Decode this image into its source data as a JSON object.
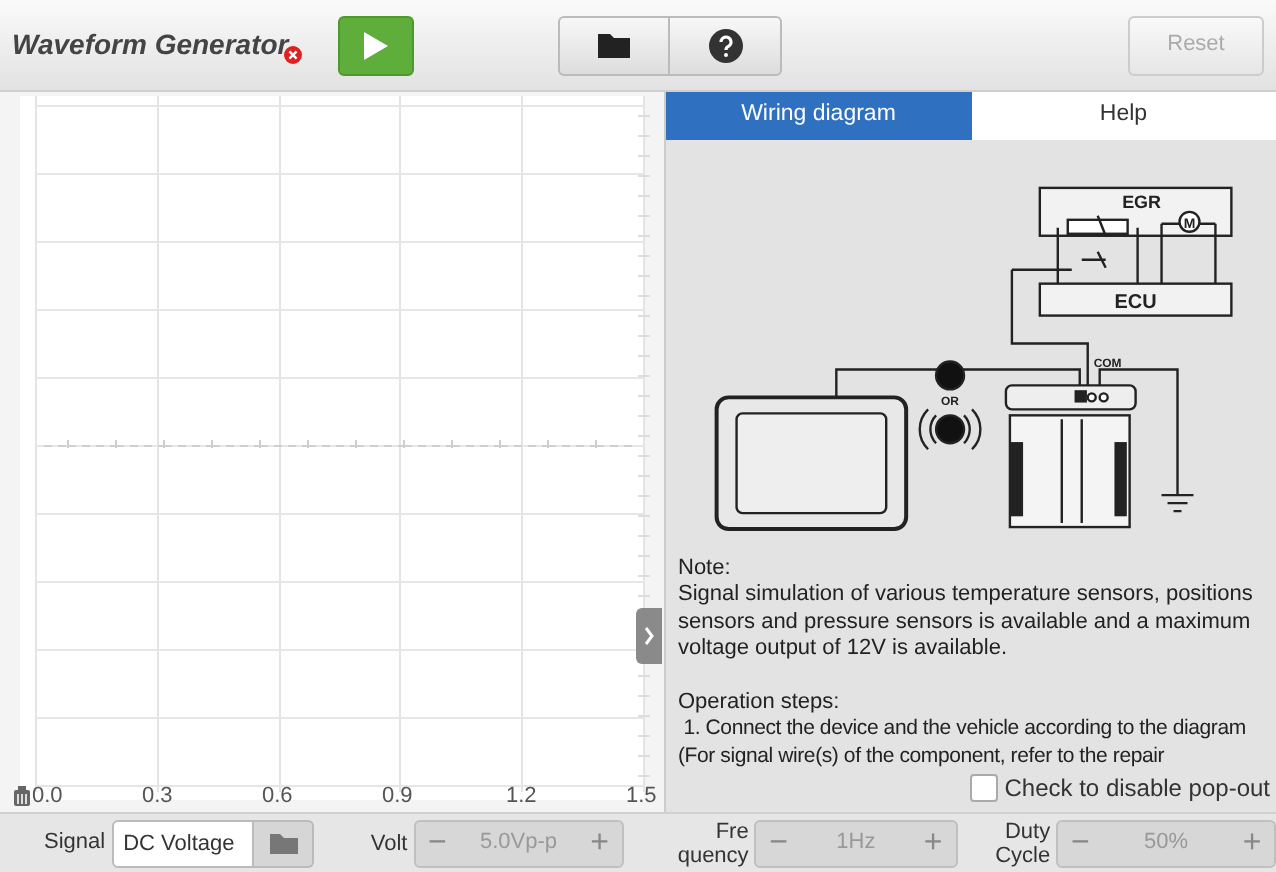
{
  "toolbar": {
    "title": "Waveform Generator",
    "running": false,
    "reset": {
      "label": "Reset",
      "disabled": true
    }
  },
  "tabs": [
    {
      "label": "Wiring diagram",
      "selected": true
    },
    {
      "label": "Help",
      "selected": false
    }
  ],
  "plot": {
    "x_labels": [
      "0.0",
      "0.3",
      "0.6",
      "0.9",
      "1.2",
      "1.5"
    ]
  },
  "diagram": {
    "labels": [
      "EGR",
      "ECU",
      "M",
      "COM",
      "OR"
    ]
  },
  "note": {
    "title": "Note:",
    "text": "Signal simulation of various temperature sensors, positions sensors and pressure sensors is available and a maximum voltage output of 12V is available.",
    "steps_title": "Operation steps:",
    "step_lines": [
      " 1. Connect the device and the vehicle according to the diagram",
      "(For signal wire(s) of the component, refer to the repair"
    ]
  },
  "popout_checkbox": {
    "label": "Check to disable pop-out",
    "checked": false
  },
  "signal": {
    "label": "Signal",
    "value": "DC Voltage"
  },
  "steppers": [
    {
      "label_lines": [
        "Volt"
      ],
      "value": "5.0Vp-p",
      "disabled": true,
      "minus": "−",
      "plus": "+"
    },
    {
      "label_lines": [
        "Fre",
        "quency"
      ],
      "value": "1Hz",
      "disabled": true,
      "minus": "−",
      "plus": "+"
    },
    {
      "label_lines": [
        "Duty",
        "Cycle"
      ],
      "value": "50%",
      "disabled": true,
      "minus": "−",
      "plus": "+"
    }
  ]
}
